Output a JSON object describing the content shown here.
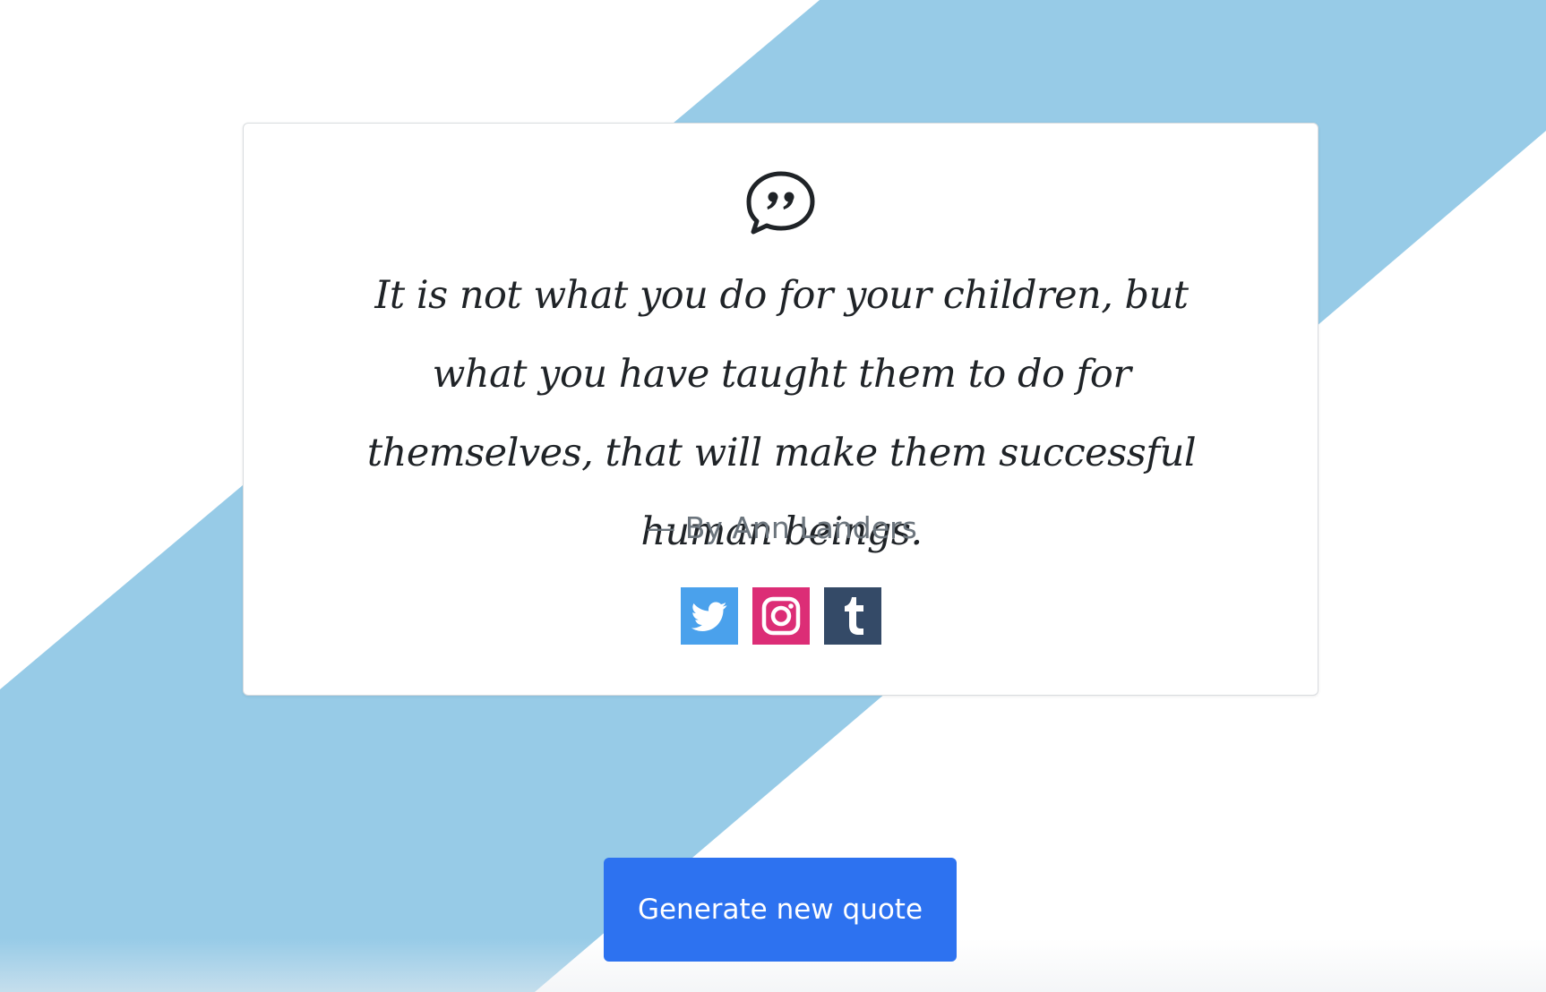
{
  "colors": {
    "stripe": "#97cbe7",
    "card_background": "#ffffff",
    "quote_text": "#1f2327",
    "author_text": "#6c757d",
    "twitter": "#4aa1ec",
    "instagram": "#dc2d76",
    "tumblr": "#344a67",
    "primary_button": "#2d72f0"
  },
  "quote": {
    "icon": "quote-bubble-icon",
    "text": "It is not what you do for your children, but what you have taught them to do for themselves, that will make them successful human beings.",
    "author": "— By Ann Landers"
  },
  "social": [
    {
      "name": "twitter",
      "icon": "twitter-icon"
    },
    {
      "name": "instagram",
      "icon": "instagram-icon"
    },
    {
      "name": "tumblr",
      "icon": "tumblr-icon"
    }
  ],
  "actions": {
    "generate_label": "Generate new quote"
  }
}
